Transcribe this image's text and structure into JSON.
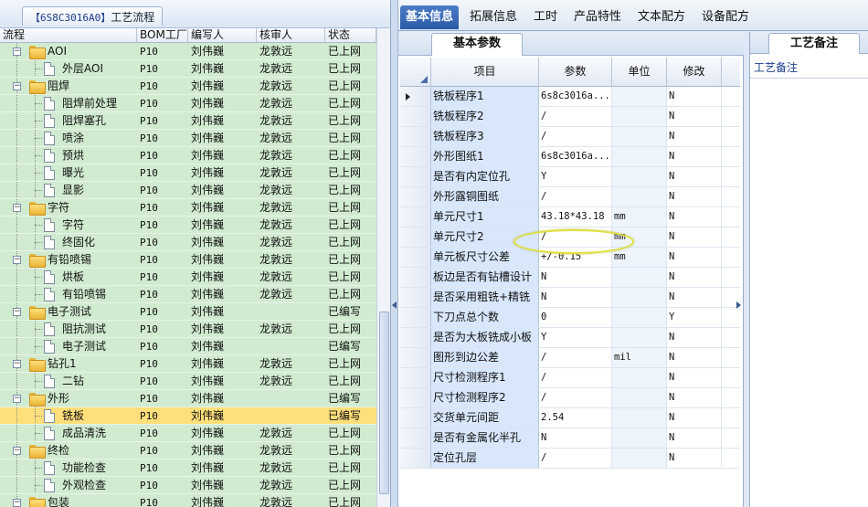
{
  "left": {
    "title_code": "【6S8C3016A0】",
    "title_text": "工艺流程",
    "columns": [
      "流程",
      "BOM工厂",
      "编写人",
      "核审人",
      "状态"
    ],
    "rows": [
      {
        "level": 1,
        "type": "folder",
        "label": "AOI",
        "bom": "P10",
        "writer": "刘伟巍",
        "reviewer": "龙敦远",
        "status": "已上网"
      },
      {
        "level": 2,
        "type": "doc",
        "label": "外层AOI",
        "bom": "P10",
        "writer": "刘伟巍",
        "reviewer": "龙敦远",
        "status": "已上网"
      },
      {
        "level": 1,
        "type": "folder",
        "label": "阻焊",
        "bom": "P10",
        "writer": "刘伟巍",
        "reviewer": "龙敦远",
        "status": "已上网"
      },
      {
        "level": 2,
        "type": "doc",
        "label": "阻焊前处理",
        "bom": "P10",
        "writer": "刘伟巍",
        "reviewer": "龙敦远",
        "status": "已上网"
      },
      {
        "level": 2,
        "type": "doc",
        "label": "阻焊塞孔",
        "bom": "P10",
        "writer": "刘伟巍",
        "reviewer": "龙敦远",
        "status": "已上网"
      },
      {
        "level": 2,
        "type": "doc",
        "label": "喷涂",
        "bom": "P10",
        "writer": "刘伟巍",
        "reviewer": "龙敦远",
        "status": "已上网"
      },
      {
        "level": 2,
        "type": "doc",
        "label": "预烘",
        "bom": "P10",
        "writer": "刘伟巍",
        "reviewer": "龙敦远",
        "status": "已上网"
      },
      {
        "level": 2,
        "type": "doc",
        "label": "曝光",
        "bom": "P10",
        "writer": "刘伟巍",
        "reviewer": "龙敦远",
        "status": "已上网"
      },
      {
        "level": 2,
        "type": "doc",
        "label": "显影",
        "bom": "P10",
        "writer": "刘伟巍",
        "reviewer": "龙敦远",
        "status": "已上网"
      },
      {
        "level": 1,
        "type": "folder",
        "label": "字符",
        "bom": "P10",
        "writer": "刘伟巍",
        "reviewer": "龙敦远",
        "status": "已上网"
      },
      {
        "level": 2,
        "type": "doc",
        "label": "字符",
        "bom": "P10",
        "writer": "刘伟巍",
        "reviewer": "龙敦远",
        "status": "已上网"
      },
      {
        "level": 2,
        "type": "doc",
        "label": "终固化",
        "bom": "P10",
        "writer": "刘伟巍",
        "reviewer": "龙敦远",
        "status": "已上网"
      },
      {
        "level": 1,
        "type": "folder",
        "label": "有铅喷锡",
        "bom": "P10",
        "writer": "刘伟巍",
        "reviewer": "龙敦远",
        "status": "已上网"
      },
      {
        "level": 2,
        "type": "doc",
        "label": "烘板",
        "bom": "P10",
        "writer": "刘伟巍",
        "reviewer": "龙敦远",
        "status": "已上网"
      },
      {
        "level": 2,
        "type": "doc",
        "label": "有铅喷锡",
        "bom": "P10",
        "writer": "刘伟巍",
        "reviewer": "龙敦远",
        "status": "已上网"
      },
      {
        "level": 1,
        "type": "folder",
        "label": "电子测试",
        "bom": "P10",
        "writer": "刘伟巍",
        "reviewer": "",
        "status": "已编写"
      },
      {
        "level": 2,
        "type": "doc",
        "label": "阻抗测试",
        "bom": "P10",
        "writer": "刘伟巍",
        "reviewer": "龙敦远",
        "status": "已上网"
      },
      {
        "level": 2,
        "type": "doc",
        "label": "电子测试",
        "bom": "P10",
        "writer": "刘伟巍",
        "reviewer": "",
        "status": "已编写"
      },
      {
        "level": 1,
        "type": "folder",
        "label": "钻孔1",
        "bom": "P10",
        "writer": "刘伟巍",
        "reviewer": "龙敦远",
        "status": "已上网"
      },
      {
        "level": 2,
        "type": "doc",
        "label": "二钻",
        "bom": "P10",
        "writer": "刘伟巍",
        "reviewer": "龙敦远",
        "status": "已上网"
      },
      {
        "level": 1,
        "type": "folder",
        "label": "外形",
        "bom": "P10",
        "writer": "刘伟巍",
        "reviewer": "",
        "status": "已编写"
      },
      {
        "level": 2,
        "type": "doc",
        "label": "铣板",
        "bom": "P10",
        "writer": "刘伟巍",
        "reviewer": "",
        "status": "已编写",
        "selected": true
      },
      {
        "level": 2,
        "type": "doc",
        "label": "成品清洗",
        "bom": "P10",
        "writer": "刘伟巍",
        "reviewer": "龙敦远",
        "status": "已上网"
      },
      {
        "level": 1,
        "type": "folder",
        "label": "终检",
        "bom": "P10",
        "writer": "刘伟巍",
        "reviewer": "龙敦远",
        "status": "已上网"
      },
      {
        "level": 2,
        "type": "doc",
        "label": "功能检查",
        "bom": "P10",
        "writer": "刘伟巍",
        "reviewer": "龙敦远",
        "status": "已上网"
      },
      {
        "level": 2,
        "type": "doc",
        "label": "外观检查",
        "bom": "P10",
        "writer": "刘伟巍",
        "reviewer": "龙敦远",
        "status": "已上网"
      },
      {
        "level": 1,
        "type": "folder",
        "label": "包装",
        "bom": "P10",
        "writer": "刘伟巍",
        "reviewer": "龙敦远",
        "status": "已上网"
      }
    ]
  },
  "tabs": [
    "基本信息",
    "拓展信息",
    "工时",
    "产品特性",
    "文本配方",
    "设备配方"
  ],
  "params": {
    "tab_label": "基本参数",
    "columns": [
      "项目",
      "参数",
      "单位",
      "修改"
    ],
    "rows": [
      {
        "item": "铣板程序1",
        "param": "6s8c3016a...",
        "unit": "",
        "mod": "N",
        "current": true
      },
      {
        "item": "铣板程序2",
        "param": "/",
        "unit": "",
        "mod": "N"
      },
      {
        "item": "铣板程序3",
        "param": "/",
        "unit": "",
        "mod": "N"
      },
      {
        "item": "外形图纸1",
        "param": "6s8c3016a...",
        "unit": "",
        "mod": "N"
      },
      {
        "item": "是否有内定位孔",
        "param": "Y",
        "unit": "",
        "mod": "N"
      },
      {
        "item": "外形露铜图纸",
        "param": "/",
        "unit": "",
        "mod": "N"
      },
      {
        "item": "单元尺寸1",
        "param": "43.18*43.18",
        "unit": "mm",
        "mod": "N"
      },
      {
        "item": "单元尺寸2",
        "param": "/",
        "unit": "mm",
        "mod": "N"
      },
      {
        "item": "单元板尺寸公差",
        "param": "+/-0.15",
        "unit": "mm",
        "mod": "N"
      },
      {
        "item": "板边是否有钻槽设计",
        "param": "N",
        "unit": "",
        "mod": "N"
      },
      {
        "item": "是否采用粗铣+精铣",
        "param": "N",
        "unit": "",
        "mod": "N"
      },
      {
        "item": "下刀点总个数",
        "param": "0",
        "unit": "",
        "mod": "Y"
      },
      {
        "item": "是否为大板铣成小板",
        "param": "Y",
        "unit": "",
        "mod": "N"
      },
      {
        "item": "图形到边公差",
        "param": "/",
        "unit": "mil",
        "mod": "N"
      },
      {
        "item": "尺寸检测程序1",
        "param": "/",
        "unit": "",
        "mod": "N"
      },
      {
        "item": "尺寸检测程序2",
        "param": "/",
        "unit": "",
        "mod": "N"
      },
      {
        "item": "交货单元间距",
        "param": "2.54",
        "unit": "",
        "mod": "N"
      },
      {
        "item": "是否有金属化半孔",
        "param": "N",
        "unit": "",
        "mod": "N"
      },
      {
        "item": "定位孔层",
        "param": "/",
        "unit": "",
        "mod": "N"
      }
    ]
  },
  "remarks": {
    "tab_label": "工艺备注",
    "label": "工艺备注"
  }
}
